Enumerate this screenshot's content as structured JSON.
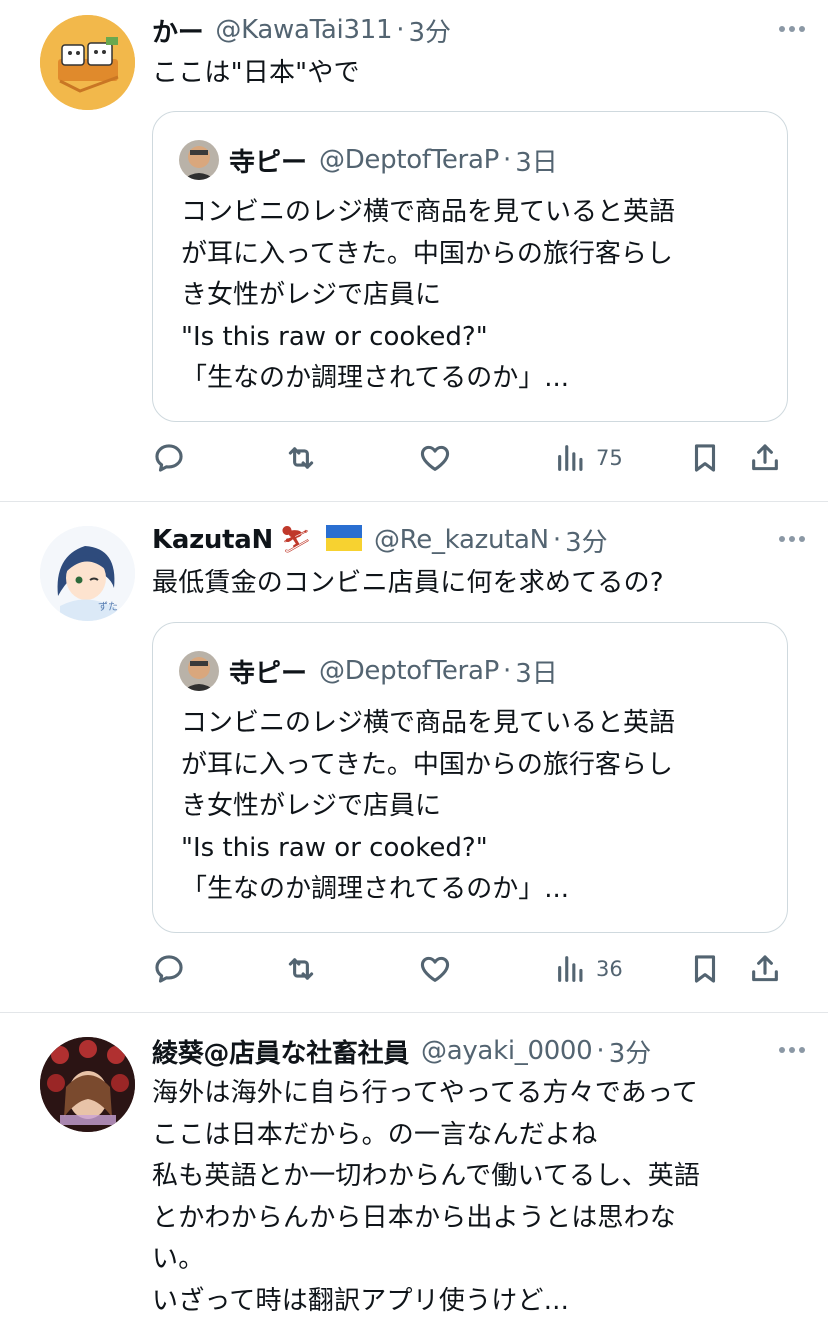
{
  "tweets": [
    {
      "name": "かー",
      "handle": "@KawaTai311",
      "separator": "·",
      "time": "3分",
      "text": "ここは\"日本\"やで",
      "quote": {
        "name": "寺ピー",
        "handle": "@DeptofTeraP",
        "separator": "·",
        "time": "3日",
        "text": "コンビニのレジ横で商品を見ていると英語\nが耳に入ってきた。中国からの旅行客らし\nき女性がレジで店員に\n\"Is this raw or cooked?\"\n「生なのか調理されてるのか」..."
      },
      "views": "75"
    },
    {
      "name": "KazutaN",
      "emoji_skier": "⛷",
      "emoji_flag": "ukraine-flag",
      "handle": "@Re_kazutaN",
      "separator": "·",
      "time": "3分",
      "text": "最低賃金のコンビニ店員に何を求めてるの?",
      "quote": {
        "name": "寺ピー",
        "handle": "@DeptofTeraP",
        "separator": "·",
        "time": "3日",
        "text": "コンビニのレジ横で商品を見ていると英語\nが耳に入ってきた。中国からの旅行客らし\nき女性がレジで店員に\n\"Is this raw or cooked?\"\n「生なのか調理されてるのか」..."
      },
      "views": "36"
    },
    {
      "name": "綾葵@店員な社畜社員",
      "handle": "@ayaki_0000",
      "separator": "·",
      "time": "3分",
      "text": "海外は海外に自ら行ってやってる方々であって\nここは日本だから。の一言なんだよね\n私も英語とか一切わからんで働いてるし、英語\nとかわからんから日本から出ようとは思わな\nい。\nいざって時は翻訳アプリ使うけど..."
    }
  ],
  "icons": {
    "reply": "reply-icon",
    "retweet": "retweet-icon",
    "like": "heart-icon",
    "views": "views-icon",
    "bookmark": "bookmark-icon",
    "share": "share-icon",
    "more": "more-dots-icon"
  },
  "colors": {
    "text": "#0f1419",
    "secondary": "#536471",
    "border": "#cfd9de",
    "separator": "#e3e6e9"
  }
}
